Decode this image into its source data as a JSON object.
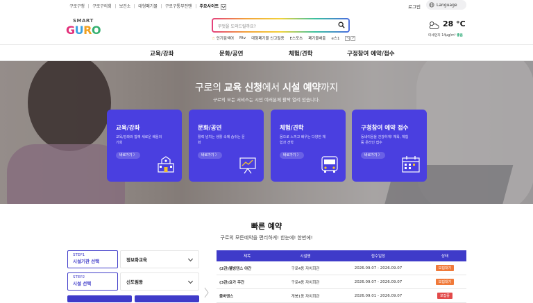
{
  "topbar": {
    "links": [
      "구로구청",
      "구로구의회",
      "보건소",
      "대형폐기물",
      "구로구통부전맨"
    ],
    "featured": "주요사이트",
    "login": "로그인",
    "language": "Language"
  },
  "logo": {
    "smart": "SMART",
    "guro": "GURO"
  },
  "search": {
    "placeholder": "무엇을 도와드릴까요?",
    "keywords_label": "인기검색어",
    "keywords": [
      "Rtv",
      "대형폐기물 신고필증",
      "E스포츠",
      "폐기물배출",
      "e스1"
    ],
    "nav_prev": "<",
    "nav_next": ">"
  },
  "weather": {
    "temp": "28 °C",
    "dust_label": "미세먼지",
    "dust_value": "14μg/m³",
    "dust_status": "좋음"
  },
  "nav": {
    "items": [
      "교육/강좌",
      "문화/공연",
      "체험/견학",
      "구정참여 예약/접수"
    ]
  },
  "hero": {
    "title_a": "구로의 ",
    "title_b": "교육 신청",
    "title_c": "에서 ",
    "title_d": "시설 예약",
    "title_e": "까지",
    "subtitle": "구로의 모든 서비스는 시민 여러분께 활짝 열려 있습니다."
  },
  "cards": [
    {
      "title": "교육/강좌",
      "desc": "교육/강좌와 함께 새로운 배움의 기회",
      "button": "바로가기 〉",
      "icon": "school-icon"
    },
    {
      "title": "문화/공연",
      "desc": "활력 넘치는 생활 속에 숨쉬는 문화",
      "button": "바로가기 〉",
      "icon": "presentation-icon"
    },
    {
      "title": "체험/견학",
      "desc": "몸으로 느끼고 배우는 다양한 체험과 견학",
      "button": "바로가기 〉",
      "icon": "bus-icon"
    },
    {
      "title": "구청참여 예약 접수",
      "desc": "동네이음을 건강하게! 체육, 체험등 온라인 접수",
      "button": "바로가기 〉",
      "icon": "calendar-icon"
    }
  ],
  "quick": {
    "title": "빠른 예약",
    "subtitle": "구로의 모든예약을 편리하게! 한눈에! 한번에!",
    "step1_num": "STEP1",
    "step1_label": "시설기관 선택",
    "step1_value": "정보화교육",
    "step2_num": "STEP2",
    "step2_label": "시설 선택",
    "step2_value": "신도림동"
  },
  "table": {
    "headers": [
      "제목",
      "시설명",
      "접수일정",
      "상태"
    ],
    "rows": [
      {
        "title": "(2관)웰빙댄스 야간",
        "facility": "구로4동 자치회관",
        "period": "2026.09.07 - 2026.09.07",
        "status": "모집대기"
      },
      {
        "title": "(3관)요가 주간",
        "facility": "구로4동 자치회관",
        "period": "2026.09.07 - 2026.09.07",
        "status": "모집대기"
      },
      {
        "title": "줌바댄스",
        "facility": "개봉1동 자치회관",
        "period": "2026.09.01 - 2026.09.07",
        "status": "모집중"
      }
    ]
  },
  "colors": {
    "accent": "#4a3fe0",
    "waiting": "#f07a3a",
    "open": "#e24a4a",
    "good": "#1aa36b"
  }
}
